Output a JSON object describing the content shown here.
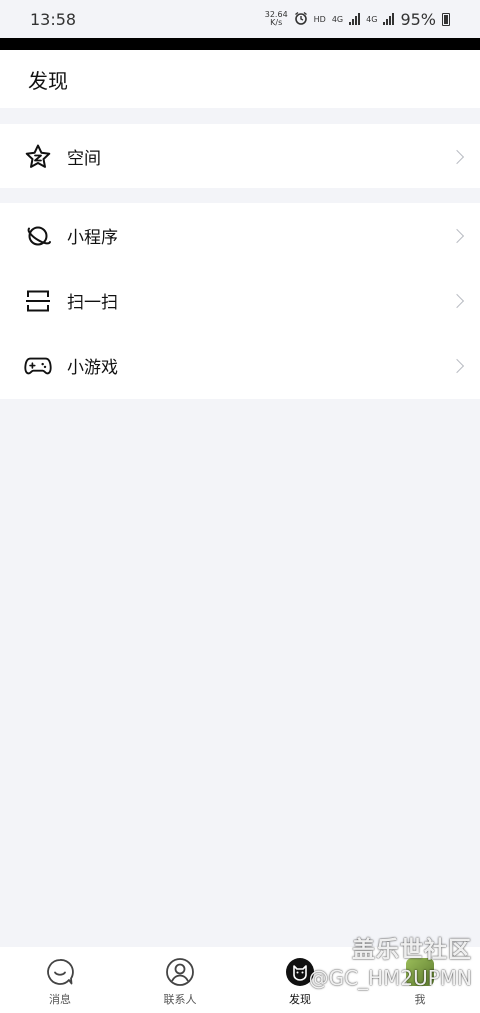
{
  "status_bar": {
    "time": "13:58",
    "net_speed_value": "32.64",
    "net_speed_unit": "K/s",
    "hd": "HD",
    "net1": "4G",
    "net2": "4G",
    "battery": "95%"
  },
  "header": {
    "title": "发现"
  },
  "sections": [
    {
      "items": [
        {
          "label": "空间",
          "icon": "star-icon"
        }
      ]
    },
    {
      "items": [
        {
          "label": "小程序",
          "icon": "planet-icon"
        },
        {
          "label": "扫一扫",
          "icon": "scan-icon"
        },
        {
          "label": "小游戏",
          "icon": "gamepad-icon"
        }
      ]
    }
  ],
  "tab_bar": {
    "tabs": [
      {
        "label": "消息",
        "icon": "message-icon"
      },
      {
        "label": "联系人",
        "icon": "contacts-icon"
      },
      {
        "label": "发现",
        "icon": "discover-icon",
        "active": true
      },
      {
        "label": "我",
        "icon": "me-avatar"
      }
    ]
  },
  "watermark": {
    "title": "盖乐世社区",
    "handle": "@GC_HM2UPMN"
  },
  "colors": {
    "background": "#f3f4f8",
    "card": "#ffffff",
    "chevron": "#b9bcc3"
  }
}
